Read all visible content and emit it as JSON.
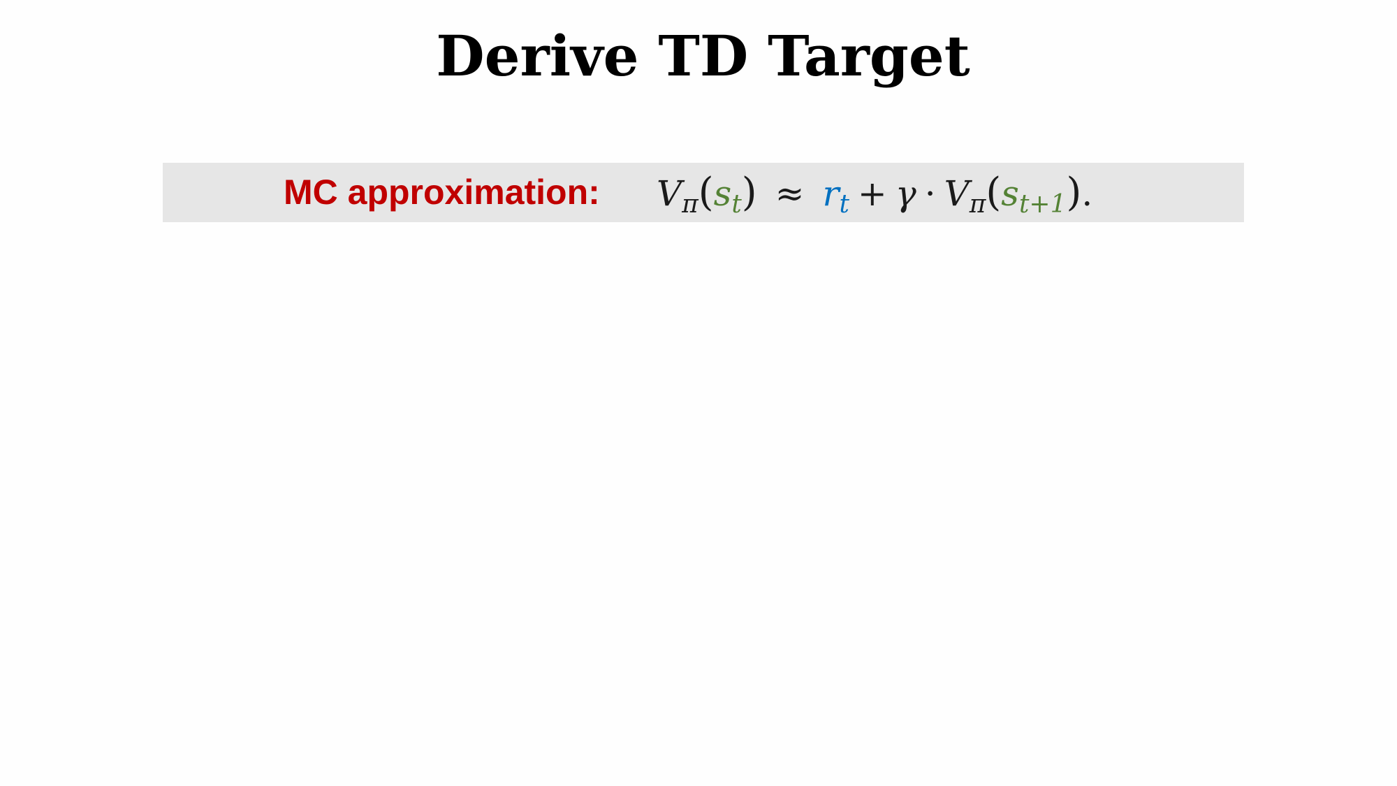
{
  "slide": {
    "title": "Derive TD Target",
    "label": "MC approximation:"
  },
  "formula": {
    "lhs_V": "V",
    "lhs_pi": "π",
    "lparen": "(",
    "lhs_s": "s",
    "lhs_t": "t",
    "rparen": ")",
    "approx": "≈",
    "r": "r",
    "r_t": "t",
    "plus": "+",
    "gamma": "γ",
    "dot": "·",
    "rhs_V": "V",
    "rhs_pi": "π",
    "rhs_lparen": "(",
    "rhs_s": "s",
    "rhs_sub": "t+1",
    "rhs_rparen": ")",
    "period": "."
  },
  "colors": {
    "label": "#c00000",
    "state": "#548235",
    "reward": "#0070c0",
    "band": "#e6e6e6"
  }
}
